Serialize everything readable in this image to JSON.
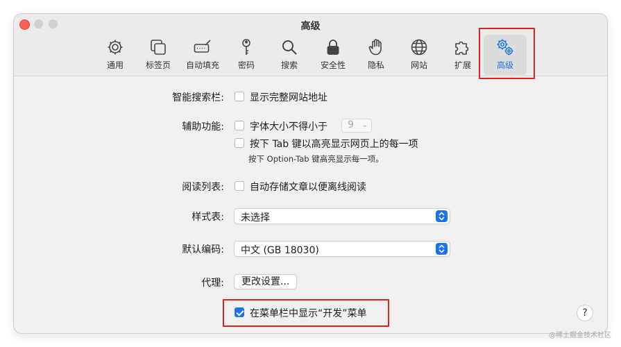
{
  "window": {
    "title": "高级"
  },
  "tabs": [
    {
      "label": "通用",
      "icon": "gear-icon"
    },
    {
      "label": "标签页",
      "icon": "tabs-icon"
    },
    {
      "label": "自动填充",
      "icon": "autofill-icon"
    },
    {
      "label": "密码",
      "icon": "key-icon"
    },
    {
      "label": "搜索",
      "icon": "search-icon"
    },
    {
      "label": "安全性",
      "icon": "lock-icon"
    },
    {
      "label": "隐私",
      "icon": "hand-icon"
    },
    {
      "label": "网站",
      "icon": "globe-icon"
    },
    {
      "label": "扩展",
      "icon": "puzzle-icon"
    },
    {
      "label": "高级",
      "icon": "gears-icon",
      "active": true
    }
  ],
  "settings": {
    "smart_search": {
      "label": "智能搜索栏:",
      "option": "显示完整网站地址",
      "checked": false
    },
    "accessibility": {
      "label": "辅助功能:",
      "min_font_option": "字体大小不得小于",
      "min_font_value": "9",
      "tab_option": "按下 Tab 键以高亮显示网页上的每一项",
      "tab_hint": "按下 Option-Tab 键高亮显示每一项。"
    },
    "reading_list": {
      "label": "阅读列表:",
      "option": "自动存储文章以便离线阅读"
    },
    "stylesheet": {
      "label": "样式表:",
      "value": "未选择"
    },
    "encoding": {
      "label": "默认编码:",
      "value": "中文 (GB 18030)"
    },
    "proxy": {
      "label": "代理:",
      "button": "更改设置..."
    },
    "develop_menu": {
      "option": "在菜单栏中显示“开发”菜单",
      "checked": true
    }
  },
  "help": "?",
  "watermark": "@稀土掘金技术社区",
  "colors": {
    "accent": "#1a73e8",
    "highlight": "#e02020"
  }
}
